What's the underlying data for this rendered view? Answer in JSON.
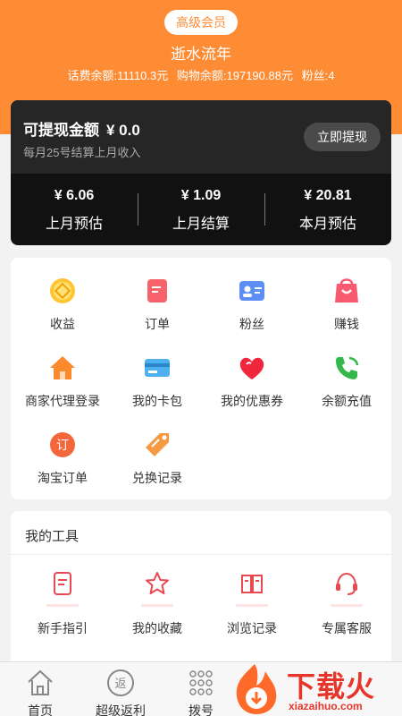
{
  "header": {
    "member_badge": "高级会员",
    "username": "逝水流年",
    "phone_balance": "话费余额:11110.3元",
    "shop_balance": "购物余额:197190.88元",
    "fans": "粉丝:4"
  },
  "wallet": {
    "withdraw_title": "可提现金额",
    "withdraw_amount": "¥ 0.0",
    "settle_note": "每月25号结算上月收入",
    "withdraw_button": "立即提现",
    "stats": [
      {
        "value": "¥ 6.06",
        "label": "上月预估"
      },
      {
        "value": "¥ 1.09",
        "label": "上月结算"
      },
      {
        "value": "¥ 20.81",
        "label": "本月预估"
      }
    ]
  },
  "grid": {
    "items": [
      {
        "label": "收益",
        "icon": "earnings-coin-icon"
      },
      {
        "label": "订单",
        "icon": "order-document-icon"
      },
      {
        "label": "粉丝",
        "icon": "fans-id-card-icon"
      },
      {
        "label": "赚钱",
        "icon": "shopping-bag-icon"
      },
      {
        "label": "商家代理登录",
        "icon": "house-icon"
      },
      {
        "label": "我的卡包",
        "icon": "card-wallet-icon"
      },
      {
        "label": "我的优惠券",
        "icon": "heart-coupon-icon"
      },
      {
        "label": "余额充值",
        "icon": "phone-icon"
      },
      {
        "label": "淘宝订单",
        "icon": "taobao-order-icon"
      },
      {
        "label": "兑换记录",
        "icon": "tag-icon"
      }
    ]
  },
  "tools": {
    "title": "我的工具",
    "items": [
      {
        "label": "新手指引",
        "icon": "guide-document-icon"
      },
      {
        "label": "我的收藏",
        "icon": "star-icon"
      },
      {
        "label": "浏览记录",
        "icon": "book-icon"
      },
      {
        "label": "专属客服",
        "icon": "headset-icon"
      }
    ]
  },
  "nav": {
    "items": [
      {
        "label": "首页",
        "icon": "home-icon"
      },
      {
        "label": "超级返利",
        "icon": "rebate-icon"
      },
      {
        "label": "拨号",
        "icon": "dialpad-icon"
      }
    ]
  },
  "watermark": {
    "text": "下载火",
    "url": "xiazaihuo.com"
  },
  "colors": {
    "brand_orange": "#fe8c35",
    "dark_card": "#111111",
    "accent_red": "#e8352a"
  }
}
